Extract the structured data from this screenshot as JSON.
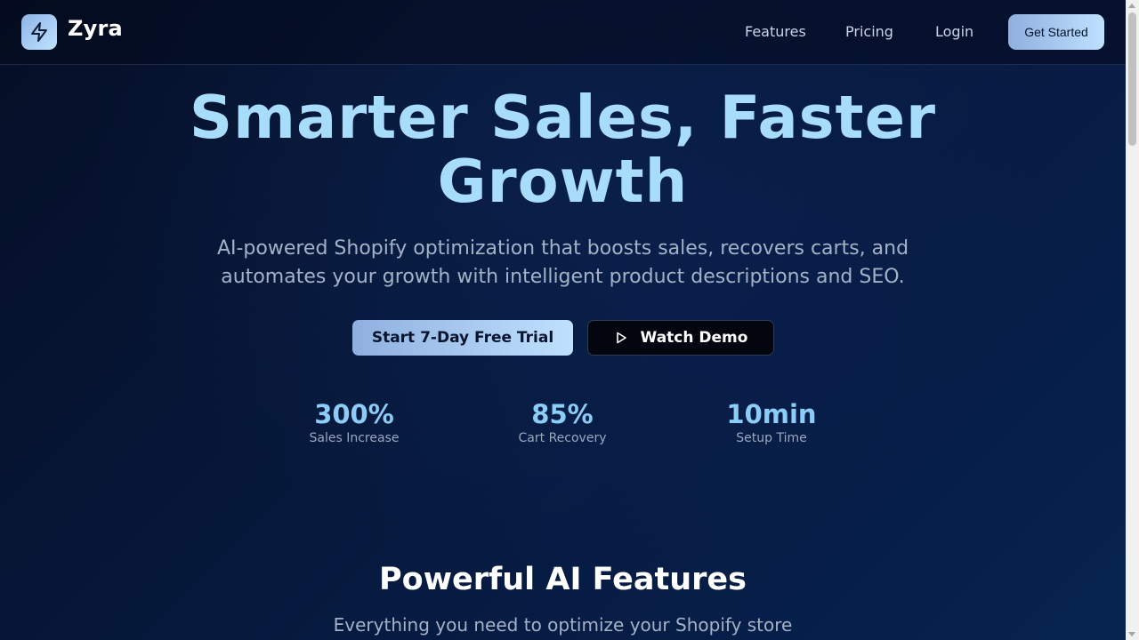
{
  "brand": {
    "name": "Zyra",
    "logo_icon": "lightning-bolt-icon"
  },
  "nav": {
    "items": [
      {
        "label": "Features"
      },
      {
        "label": "Pricing"
      },
      {
        "label": "Login"
      }
    ],
    "cta_label": "Get Started"
  },
  "hero": {
    "title_line1": "Smarter Sales, Faster",
    "title_line2": "Growth",
    "subtitle_line1": "AI-powered Shopify optimization that boosts sales, recovers carts, and",
    "subtitle_line2": "automates your growth with intelligent product descriptions and SEO.",
    "primary_cta": "Start 7-Day Free Trial",
    "secondary_cta": "Watch Demo",
    "secondary_cta_icon": "play-icon"
  },
  "stats": [
    {
      "value": "300%",
      "label": "Sales Increase"
    },
    {
      "value": "85%",
      "label": "Cart Recovery"
    },
    {
      "value": "10min",
      "label": "Setup Time"
    }
  ],
  "features": {
    "title": "Powerful AI Features",
    "subtitle": "Everything you need to optimize your Shopify store"
  },
  "colors": {
    "background": "#061a40",
    "accent_light": "#bfe1ff",
    "accent_dark": "#8fb0de",
    "title": "#a8dcfb",
    "stat_value": "#8ccdf7"
  }
}
